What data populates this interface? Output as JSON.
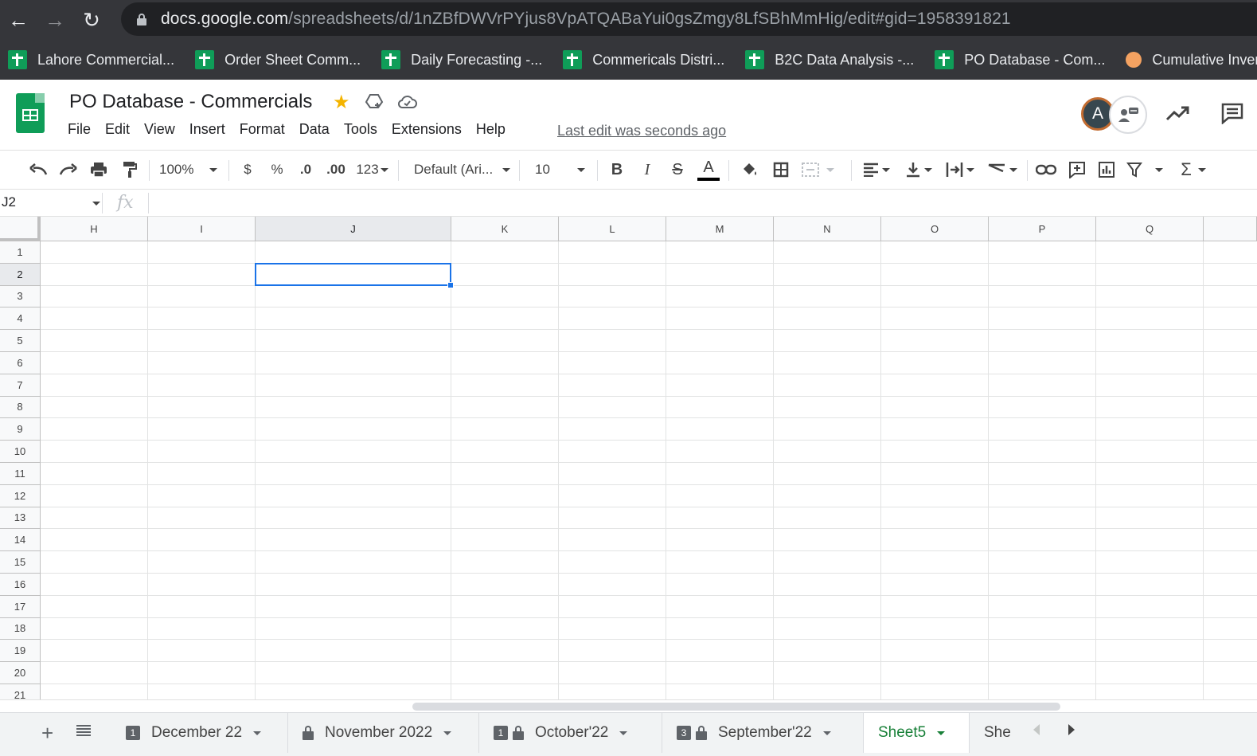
{
  "browser": {
    "url_host": "docs.google.com",
    "url_path": "/spreadsheets/d/1nZBfDWVrPYjus8VpATQABaYui0gsZmgy8LfSBhMmHig/edit#gid=1958391821",
    "bookmarks": [
      {
        "label": "Lahore Commercial...",
        "icon": "sheets-icon"
      },
      {
        "label": "Order Sheet Comm...",
        "icon": "sheets-icon"
      },
      {
        "label": "Daily Forecasting -...",
        "icon": "sheets-icon"
      },
      {
        "label": "Commericals Distri...",
        "icon": "sheets-icon"
      },
      {
        "label": "B2C Data Analysis -...",
        "icon": "sheets-icon"
      },
      {
        "label": "PO Database - Com...",
        "icon": "sheets-icon"
      },
      {
        "label": "Cumulative Inventory",
        "icon": "chart-icon"
      }
    ]
  },
  "doc": {
    "title": "PO Database - Commercials",
    "menu": [
      "File",
      "Edit",
      "View",
      "Insert",
      "Format",
      "Data",
      "Tools",
      "Extensions",
      "Help"
    ],
    "last_edit": "Last edit was seconds ago",
    "avatar_letter": "A"
  },
  "toolbar": {
    "zoom": "100%",
    "currency": "$",
    "percent": "%",
    "decrease_decimals": ".0",
    "increase_decimals": ".00",
    "more_formats": "123",
    "font": "Default (Ari...",
    "font_size": "10",
    "bold": "B",
    "italic": "I",
    "strike": "S",
    "text_color": "A",
    "sum": "Σ"
  },
  "formula_bar": {
    "name_box": "J2",
    "fx": "fx",
    "value": ""
  },
  "grid": {
    "columns": [
      "H",
      "I",
      "J",
      "K",
      "L",
      "M",
      "N",
      "O",
      "P",
      "Q"
    ],
    "rows": [
      "1",
      "2",
      "3",
      "4",
      "5",
      "6",
      "7",
      "8",
      "9",
      "10",
      "11",
      "12",
      "13",
      "14",
      "15",
      "16",
      "17",
      "18",
      "19",
      "20",
      "21"
    ],
    "selected_column": "J",
    "selected_row": "2"
  },
  "tabs": [
    {
      "label": "December 22",
      "badge": "1",
      "locked": false,
      "active": false
    },
    {
      "label": "November 2022",
      "badge": "",
      "locked": true,
      "active": false
    },
    {
      "label": "October'22",
      "badge": "1",
      "locked": true,
      "active": false
    },
    {
      "label": "September'22",
      "badge": "3",
      "locked": true,
      "active": false
    },
    {
      "label": "Sheet5",
      "badge": "",
      "locked": false,
      "active": true
    },
    {
      "label": "She",
      "badge": "",
      "locked": false,
      "active": false
    }
  ],
  "colors": {
    "accent": "#1a73e8",
    "sheets_green": "#0f9d58",
    "active_tab": "#188038",
    "star": "#f4b400"
  }
}
